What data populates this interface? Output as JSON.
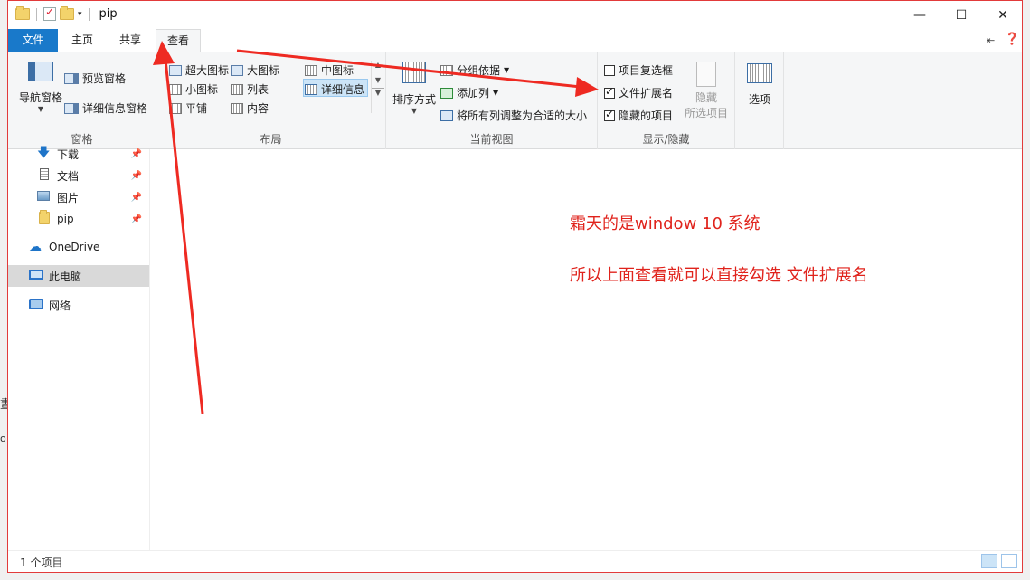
{
  "window": {
    "title": "pip",
    "controls": {
      "minimize": "—",
      "maximize": "☐",
      "close": "✕"
    }
  },
  "tabs": [
    {
      "label": "文件"
    },
    {
      "label": "主页"
    },
    {
      "label": "共享"
    },
    {
      "label": "查看"
    }
  ],
  "ribbon": {
    "panes": {
      "label": "窗格",
      "nav_pane": "导航窗格",
      "preview_pane": "预览窗格",
      "details_pane": "详细信息窗格"
    },
    "layout": {
      "label": "布局",
      "items": [
        "超大图标",
        "大图标",
        "中图标",
        "小图标",
        "列表",
        "详细信息",
        "平铺",
        "内容"
      ]
    },
    "current_view": {
      "label": "当前视图",
      "sort_by": "排序方式",
      "group_by": "分组依据",
      "add_column": "添加列",
      "size_all": "将所有列调整为合适的大小"
    },
    "show_hide": {
      "label": "显示/隐藏",
      "item_checkboxes": "项目复选框",
      "item_checkboxes_checked": false,
      "file_extensions": "文件扩展名",
      "file_extensions_checked": true,
      "hidden_items": "隐藏的项目",
      "hidden_items_checked": true,
      "hide_selected_line1": "隐藏",
      "hide_selected_line2": "所选项目"
    },
    "options": {
      "label": "选项"
    }
  },
  "nav": {
    "items": [
      {
        "label": "下载",
        "icon": "download-icon",
        "pinned": true
      },
      {
        "label": "文档",
        "icon": "document-icon",
        "pinned": true
      },
      {
        "label": "图片",
        "icon": "pictures-icon",
        "pinned": true
      },
      {
        "label": "pip",
        "icon": "folder-icon",
        "pinned": true
      },
      {
        "label": "OneDrive",
        "icon": "cloud-icon"
      },
      {
        "label": "此电脑",
        "icon": "computer-icon",
        "selected": true
      },
      {
        "label": "网络",
        "icon": "network-icon"
      }
    ]
  },
  "annotations": {
    "line1": "霜天的是window 10 系统",
    "line2": "所以上面查看就可以直接勾选 文件扩展名"
  },
  "status": {
    "item_count": "1 个项目"
  },
  "colors": {
    "accent": "#1979ca",
    "annotation": "#e0231c"
  }
}
